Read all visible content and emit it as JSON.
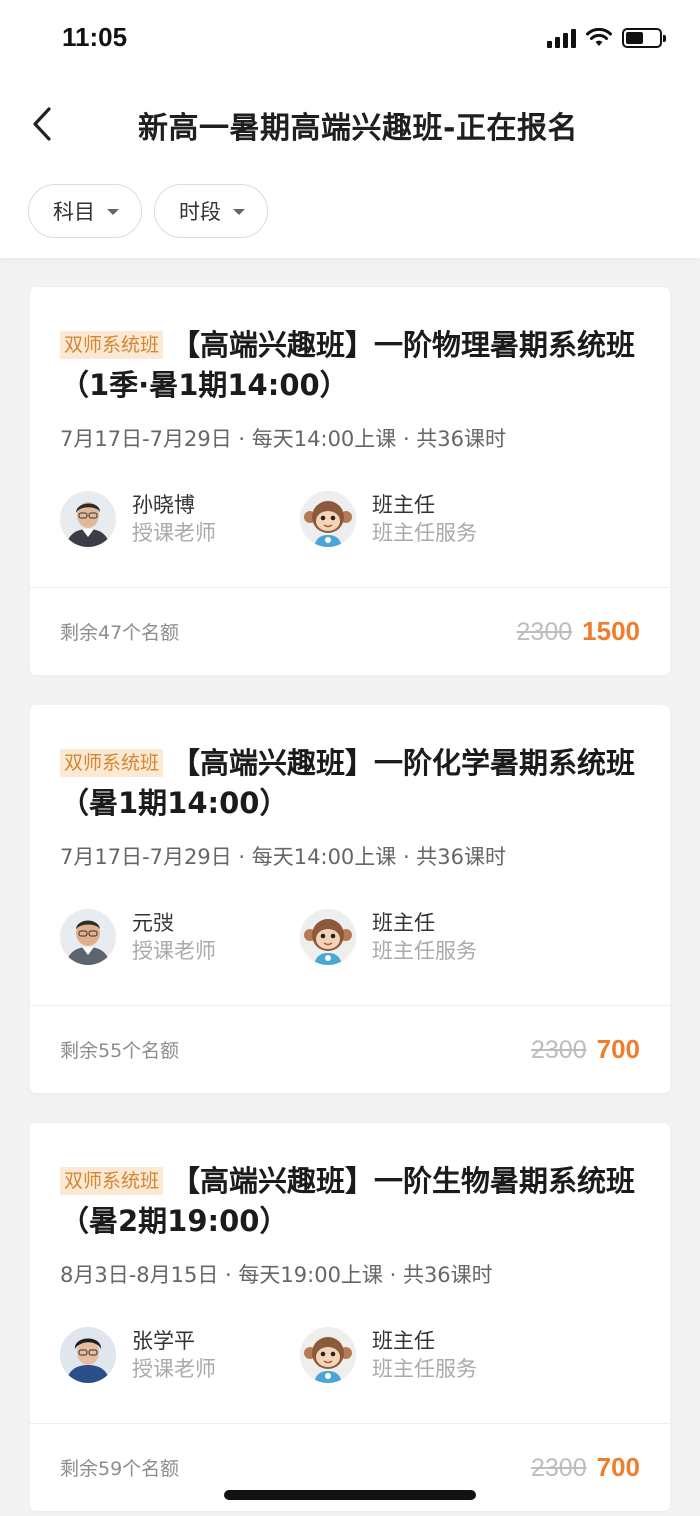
{
  "status_bar": {
    "time": "11:05"
  },
  "header": {
    "title": "新高一暑期高端兴趣班-正在报名"
  },
  "filters": [
    {
      "label": "科目"
    },
    {
      "label": "时段"
    }
  ],
  "courses": [
    {
      "tag": "双师系统班",
      "title": "【高端兴趣班】一阶物理暑期系统班（1季·暑1期14:00）",
      "meta": "7月17日-7月29日 · 每天14:00上课 · 共36课时",
      "teacher": {
        "name": "孙晓博",
        "role": "授课老师"
      },
      "assistant": {
        "name": "班主任",
        "role": "班主任服务"
      },
      "remaining": "剩余47个名额",
      "old_price": "2300",
      "price": "1500"
    },
    {
      "tag": "双师系统班",
      "title": "【高端兴趣班】一阶化学暑期系统班（暑1期14:00）",
      "meta": "7月17日-7月29日 · 每天14:00上课 · 共36课时",
      "teacher": {
        "name": "元弢",
        "role": "授课老师"
      },
      "assistant": {
        "name": "班主任",
        "role": "班主任服务"
      },
      "remaining": "剩余55个名额",
      "old_price": "2300",
      "price": "700"
    },
    {
      "tag": "双师系统班",
      "title": "【高端兴趣班】一阶生物暑期系统班（暑2期19:00）",
      "meta": "8月3日-8月15日 · 每天19:00上课 · 共36课时",
      "teacher": {
        "name": "张学平",
        "role": "授课老师"
      },
      "assistant": {
        "name": "班主任",
        "role": "班主任服务"
      },
      "remaining": "剩余59个名额",
      "old_price": "2300",
      "price": "700"
    }
  ]
}
